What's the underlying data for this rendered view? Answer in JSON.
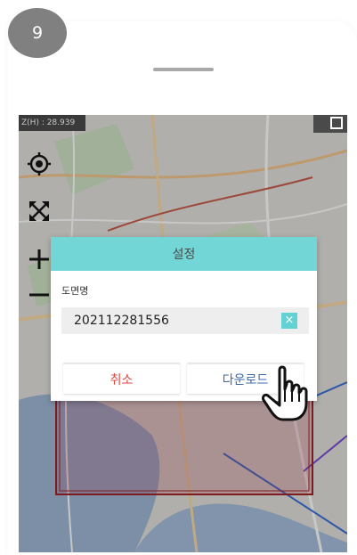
{
  "step": {
    "number": "9"
  },
  "map": {
    "coord_readout": "Z(H) : 28.939"
  },
  "dialog": {
    "title": "설정",
    "label": "도면명",
    "input_value": "202112281556",
    "clear_symbol": "×",
    "cancel_label": "취소",
    "download_label": "다운로드"
  },
  "colors": {
    "header": "#73d6d6",
    "cancel": "#e0473f",
    "download": "#3d6aa8",
    "selection_box": "#a0242a"
  },
  "icons": [
    "location-target-icon",
    "fullscreen-icon",
    "zoom-in-icon",
    "zoom-out-icon",
    "pointing-hand-icon",
    "close-icon"
  ]
}
